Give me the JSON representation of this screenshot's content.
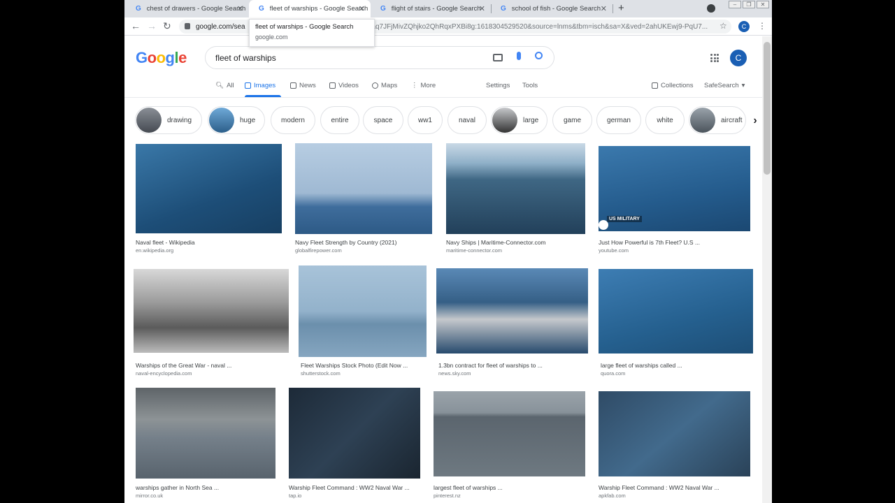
{
  "browser": {
    "tabs": [
      {
        "label": "chest of drawers - Google Search"
      },
      {
        "label": "fleet of warships - Google Search"
      },
      {
        "label": "flight of stairs - Google Search"
      },
      {
        "label": "school of fish - Google Search"
      }
    ],
    "url": "google.com/sea",
    "url_rest": "taq7JFjMivZQhjko2QhRqxPXBi8g:1618304529520&source=lnms&tbm=isch&sa=X&ved=2ahUKEwj9-PqU7...",
    "profile_initial": "C",
    "tooltip": {
      "title": "fleet of warships - Google Search",
      "domain": "google.com"
    }
  },
  "google": {
    "logo": [
      "G",
      "o",
      "o",
      "g",
      "l",
      "e"
    ],
    "query": "fleet of warships",
    "avatar": "C",
    "nav": {
      "all": "All",
      "images": "Images",
      "news": "News",
      "videos": "Videos",
      "maps": "Maps",
      "more": "More",
      "settings": "Settings",
      "tools": "Tools",
      "collections": "Collections",
      "safesearch": "SafeSearch"
    },
    "chips": [
      "drawing",
      "huge",
      "modern",
      "entire",
      "space",
      "ww1",
      "naval",
      "large",
      "game",
      "german",
      "white",
      "aircraft"
    ]
  },
  "results": [
    {
      "title": "Naval fleet - Wikipedia",
      "source": "en.wikipedia.org"
    },
    {
      "title": "Navy Fleet Strength by Country (2021)",
      "source": "globalfirepower.com"
    },
    {
      "title": "Navy Ships | Maritime-Connector.com",
      "source": "maritime-connector.com"
    },
    {
      "title": "Just How Powerful is 7th Fleet? U.S ...",
      "source": "youtube.com",
      "badge": "US MILITARY"
    },
    {
      "title": "Warships of the Great War - naval ...",
      "source": "naval-encyclopedia.com"
    },
    {
      "title": "Fleet Warships Stock Photo (Edit Now ...",
      "source": "shutterstock.com"
    },
    {
      "title": "1.3bn contract for fleet of warships to ...",
      "source": "news.sky.com"
    },
    {
      "title": "large fleet of warships called ...",
      "source": "quora.com"
    },
    {
      "title": "warships gather in North Sea ...",
      "source": "mirror.co.uk"
    },
    {
      "title": "Warship Fleet Command : WW2 Naval War ...",
      "source": "tap.io"
    },
    {
      "title": "largest fleet of warships ...",
      "source": "pinterest.nz"
    },
    {
      "title": "Warship Fleet Command : WW2 Naval War ...",
      "source": "apkfab.com"
    }
  ]
}
